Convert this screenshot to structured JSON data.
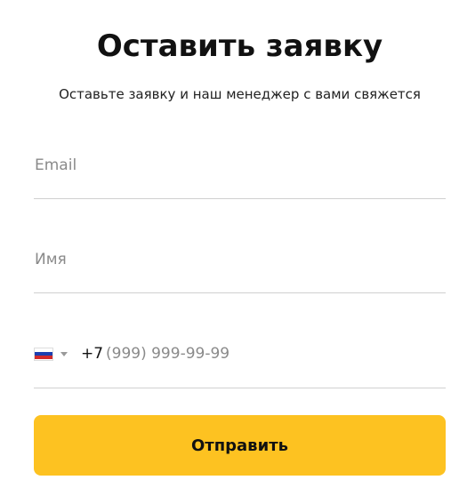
{
  "form": {
    "title": "Оставить заявку",
    "subtitle": "Оставьте заявку и наш менеджер с вами свяжется",
    "email": {
      "placeholder": "Email",
      "value": ""
    },
    "name": {
      "placeholder": "Имя",
      "value": ""
    },
    "phone": {
      "country_icon": "russia-flag-icon",
      "dial_code": "+7",
      "placeholder": "(999) 999-99-99",
      "value": ""
    },
    "submit_label": "Отправить"
  },
  "colors": {
    "accent": "#fdc221",
    "text": "#111111",
    "placeholder": "#8a8a8a",
    "divider": "#d0d0d0"
  }
}
